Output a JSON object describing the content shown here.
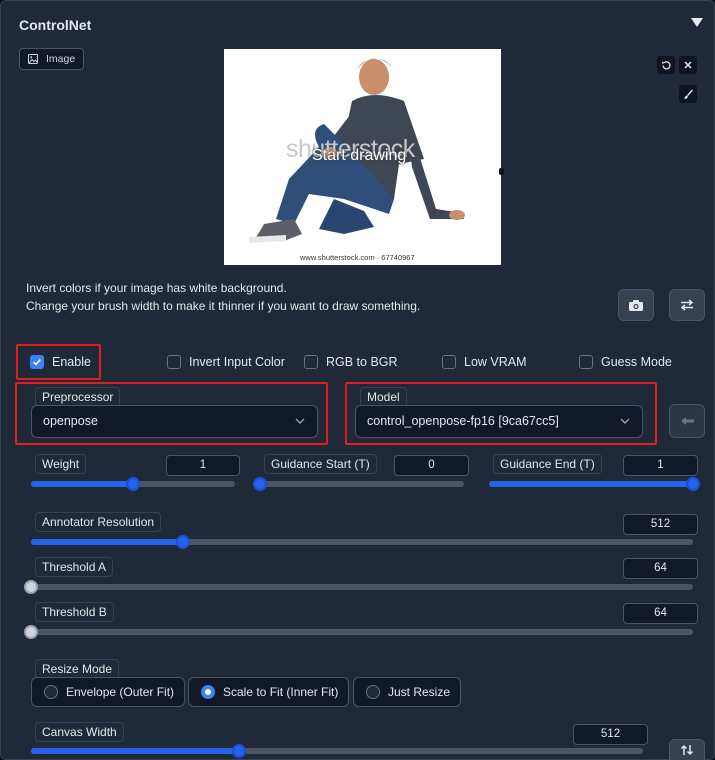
{
  "panel": {
    "title": "ControlNet"
  },
  "image_tab": {
    "label": "Image"
  },
  "canvas": {
    "watermark": "shutterstock",
    "start_drawing": "Start drawing",
    "footer": "www.shutterstock.com · 67740967"
  },
  "hints": {
    "line1": "Invert colors if your image has white background.",
    "line2": "Change your brush width to make it thinner if you want to draw something."
  },
  "checkboxes": {
    "enable": {
      "label": "Enable",
      "checked": true
    },
    "invert": {
      "label": "Invert Input Color",
      "checked": false
    },
    "rgb_bgr": {
      "label": "RGB to BGR",
      "checked": false
    },
    "low_vram": {
      "label": "Low VRAM",
      "checked": false
    },
    "guess_mode": {
      "label": "Guess Mode",
      "checked": false
    }
  },
  "preprocessor": {
    "label": "Preprocessor",
    "value": "openpose"
  },
  "model": {
    "label": "Model",
    "value": "control_openpose-fp16 [9ca67cc5]"
  },
  "sliders": {
    "weight": {
      "label": "Weight",
      "value": "1",
      "fraction": 0.5
    },
    "guidance_start": {
      "label": "Guidance Start (T)",
      "value": "0",
      "fraction": 0.0
    },
    "guidance_end": {
      "label": "Guidance End (T)",
      "value": "1",
      "fraction": 1.0
    },
    "annotator_resolution": {
      "label": "Annotator Resolution",
      "value": "512",
      "fraction": 0.23
    },
    "threshold_a": {
      "label": "Threshold A",
      "value": "64",
      "fraction": 0.0
    },
    "threshold_b": {
      "label": "Threshold B",
      "value": "64",
      "fraction": 0.0
    },
    "canvas_width": {
      "label": "Canvas Width",
      "value": "512",
      "fraction": 0.34
    }
  },
  "resize_mode": {
    "label": "Resize Mode",
    "options": [
      "Envelope (Outer Fit)",
      "Scale to Fit (Inner Fit)",
      "Just Resize"
    ],
    "selected": "Scale to Fit (Inner Fit)"
  },
  "colors": {
    "accent": "#2563eb",
    "highlight_box": "#e11d1d",
    "panel_bg": "#1f2937"
  },
  "icons": {
    "image_tab": "image-icon",
    "undo": "undo-icon",
    "close": "close-icon",
    "brush": "brush-icon",
    "camera": "camera-icon",
    "swap": "swap-icon",
    "send": "send-dimensions-icon",
    "swap_vertical": "swap-vertical-icon"
  }
}
